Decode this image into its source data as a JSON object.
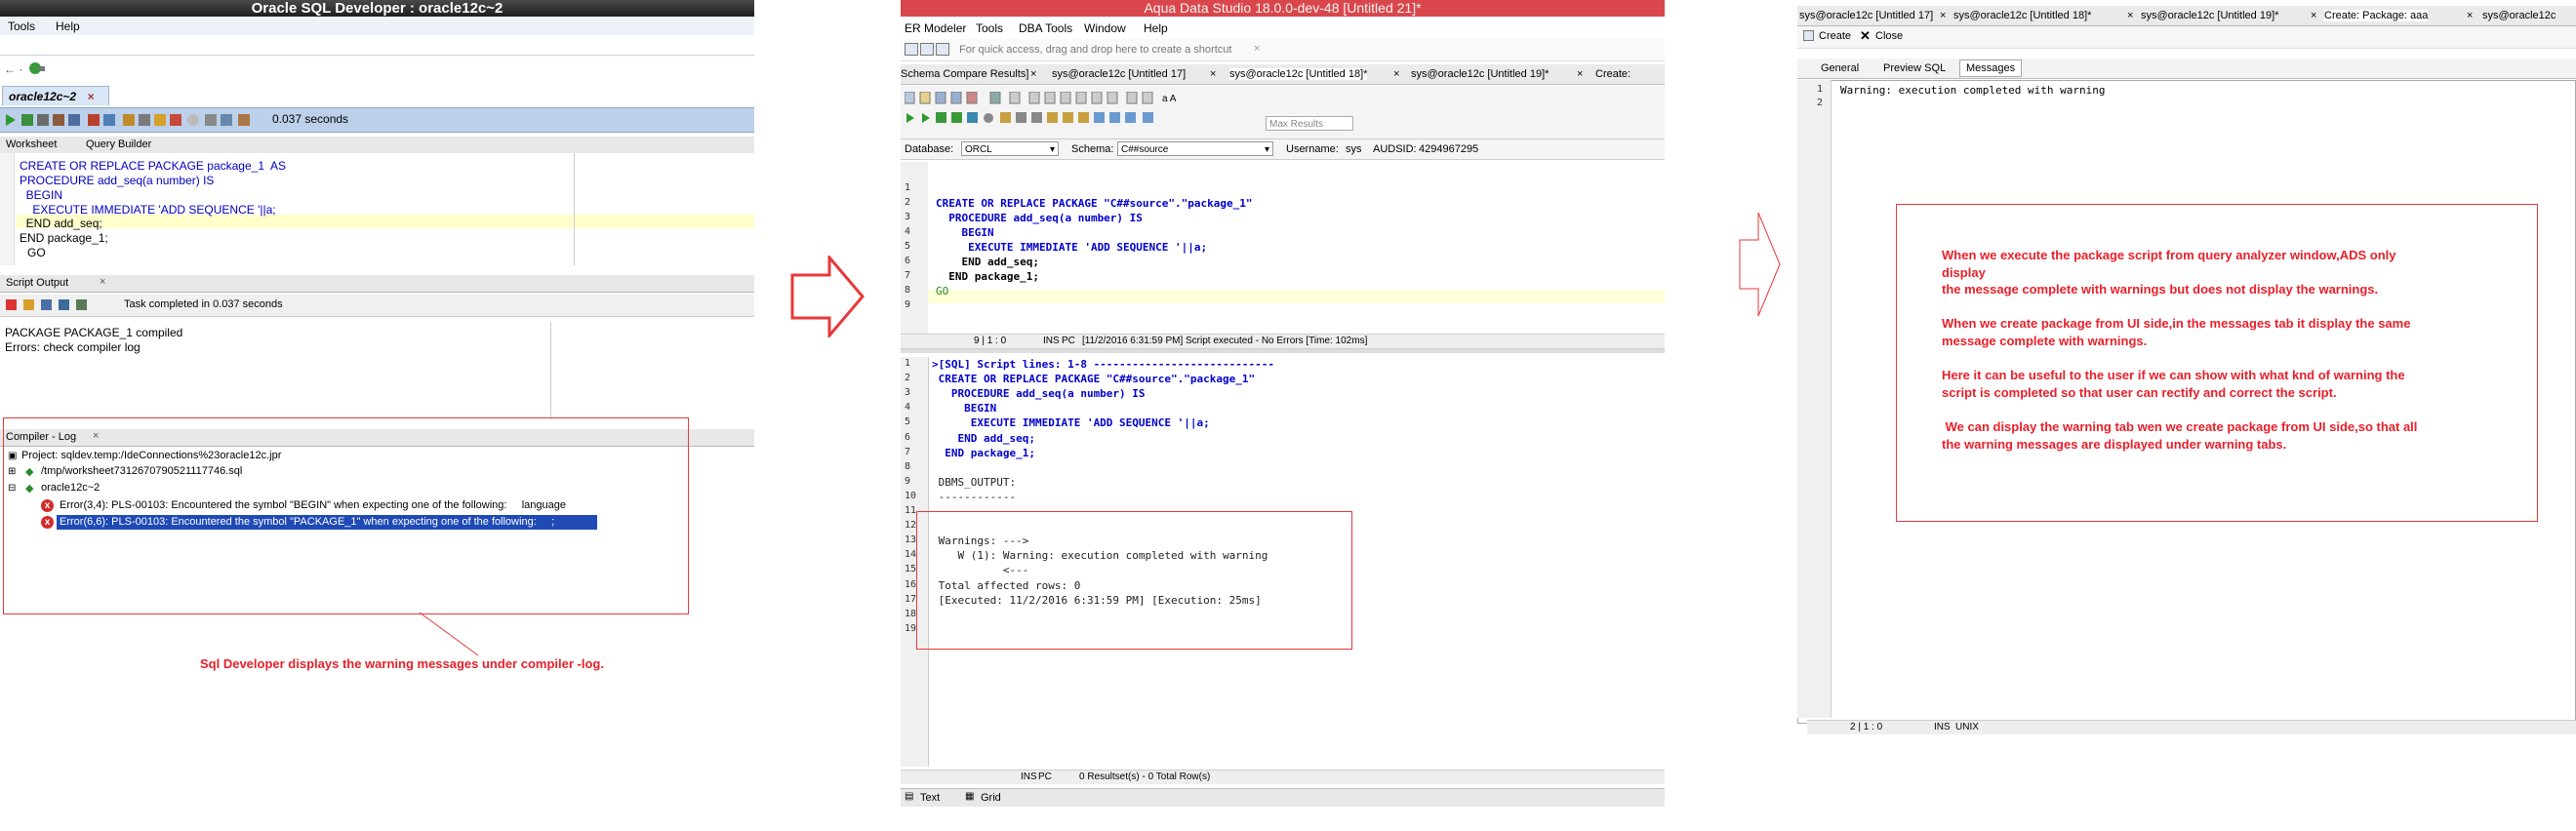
{
  "sqldev": {
    "window_title": "Oracle SQL Developer : oracle12c~2",
    "menu": [
      "Tools",
      "Help"
    ],
    "doc_tab": "oracle12c~2",
    "elapsed": "0.037 seconds",
    "tabs": [
      "Worksheet",
      "Query Builder"
    ],
    "code": [
      "CREATE OR REPLACE PACKAGE package_1  AS",
      "PROCEDURE add_seq(a number) IS",
      "  BEGIN",
      "    EXECUTE IMMEDIATE 'ADD SEQUENCE '||a;",
      "  END add_seq;",
      "END package_1;",
      "GO"
    ],
    "script_output_tab": "Script Output",
    "task_status": "Task completed in 0.037 seconds",
    "output": [
      "PACKAGE PACKAGE_1 compiled",
      "Errors: check compiler log"
    ],
    "compiler_log_tab": "Compiler - Log",
    "tree": {
      "project": "Project: sqldev.temp:/IdeConnections%23oracle12c.jpr",
      "worksheet": "/tmp/worksheet7312670790521117746.sql",
      "connection": "oracle12c~2",
      "errors": [
        "Error(3,4): PLS-00103: Encountered the symbol \"BEGIN\" when expecting one of the following:     language",
        "Error(6,6): PLS-00103: Encountered the symbol \"PACKAGE_1\" when expecting one of the following:     ;"
      ]
    },
    "annotation": "Sql Developer displays the warning messages under compiler -log."
  },
  "ads": {
    "window_title": "Aqua Data Studio 18.0.0-dev-48 [Untitled 21]*",
    "menu": [
      "ER Modeler",
      "Tools",
      "DBA Tools",
      "Window",
      "Help"
    ],
    "quick_access": "For quick access, drag and drop here to create a shortcut",
    "tabs": [
      "Schema Compare Results]",
      "sys@oracle12c [Untitled 17]",
      "sys@oracle12c [Untitled 18]*",
      "sys@oracle12c [Untitled 19]*",
      "Create:"
    ],
    "max_results_placeholder": "Max Results",
    "database_label": "Database:",
    "database_value": "ORCL",
    "schema_label": "Schema:",
    "schema_value": "C##source",
    "username_label": "Username:",
    "username_value": "sys",
    "audsid_label": "AUDSID:",
    "audsid_value": "4294967295",
    "code": [
      "",
      "CREATE OR REPLACE PACKAGE \"C##source\".\"package_1\"",
      "  PROCEDURE add_seq(a number) IS",
      "    BEGIN",
      "     EXECUTE IMMEDIATE 'ADD SEQUENCE '||a;",
      "    END add_seq;",
      "  END package_1;",
      "GO",
      ""
    ],
    "status_pos": "9 | 1 : 0",
    "status_ins": "INS",
    "status_pc": "PC",
    "status_msg": "[11/2/2016 6:31:59 PM] Script executed - No Errors [Time: 102ms]",
    "results": [
      ">[SQL] Script lines: 1-8 ----------------------------",
      " CREATE OR REPLACE PACKAGE \"C##source\".\"package_1\"",
      "   PROCEDURE add_seq(a number) IS",
      "     BEGIN",
      "      EXECUTE IMMEDIATE 'ADD SEQUENCE '||a;",
      "    END add_seq;",
      "  END package_1;",
      "",
      " DBMS_OUTPUT:",
      " ------------",
      "",
      "",
      " Warnings: --->",
      "    W (1): Warning: execution completed with warning",
      "           <---",
      " Total affected rows: 0",
      " [Executed: 11/2/2016 6:31:59 PM] [Execution: 25ms]",
      "",
      ""
    ],
    "status2_ins": "INS",
    "status2_pc": "PC",
    "status2_msg": "0 Resultset(s) - 0 Total Row(s)",
    "bottom_tabs": [
      "Text",
      "Grid"
    ]
  },
  "ads2": {
    "tabs": [
      "sys@oracle12c [Untitled 17]",
      "sys@oracle12c [Untitled 18]*",
      "sys@oracle12c [Untitled 19]*",
      "Create: Package: aaa",
      "sys@oracle12c"
    ],
    "create_label": "Create",
    "close_label": "Close",
    "subtabs": [
      "General",
      "Preview SQL",
      "Messages"
    ],
    "messages": [
      "Warning: execution completed with warning",
      ""
    ],
    "status_pos": "2 | 1 : 0",
    "status_ins": "INS",
    "status_unix": "UNIX",
    "note": [
      "When we execute the package script from query analyzer window,ADS only",
      "display",
      "the message complete with warnings but does not display the warnings.",
      "",
      "When we create package from UI side,in the messages tab it display the same",
      "message complete with warnings.",
      "",
      "Here it can be useful to the user if we can show with what knd of warning the",
      "script is completed so that user can rectify and correct the script.",
      "",
      " We can display the warning tab wen we create package from UI side,so that all",
      "the warning messages are displayed under warning tabs."
    ]
  }
}
